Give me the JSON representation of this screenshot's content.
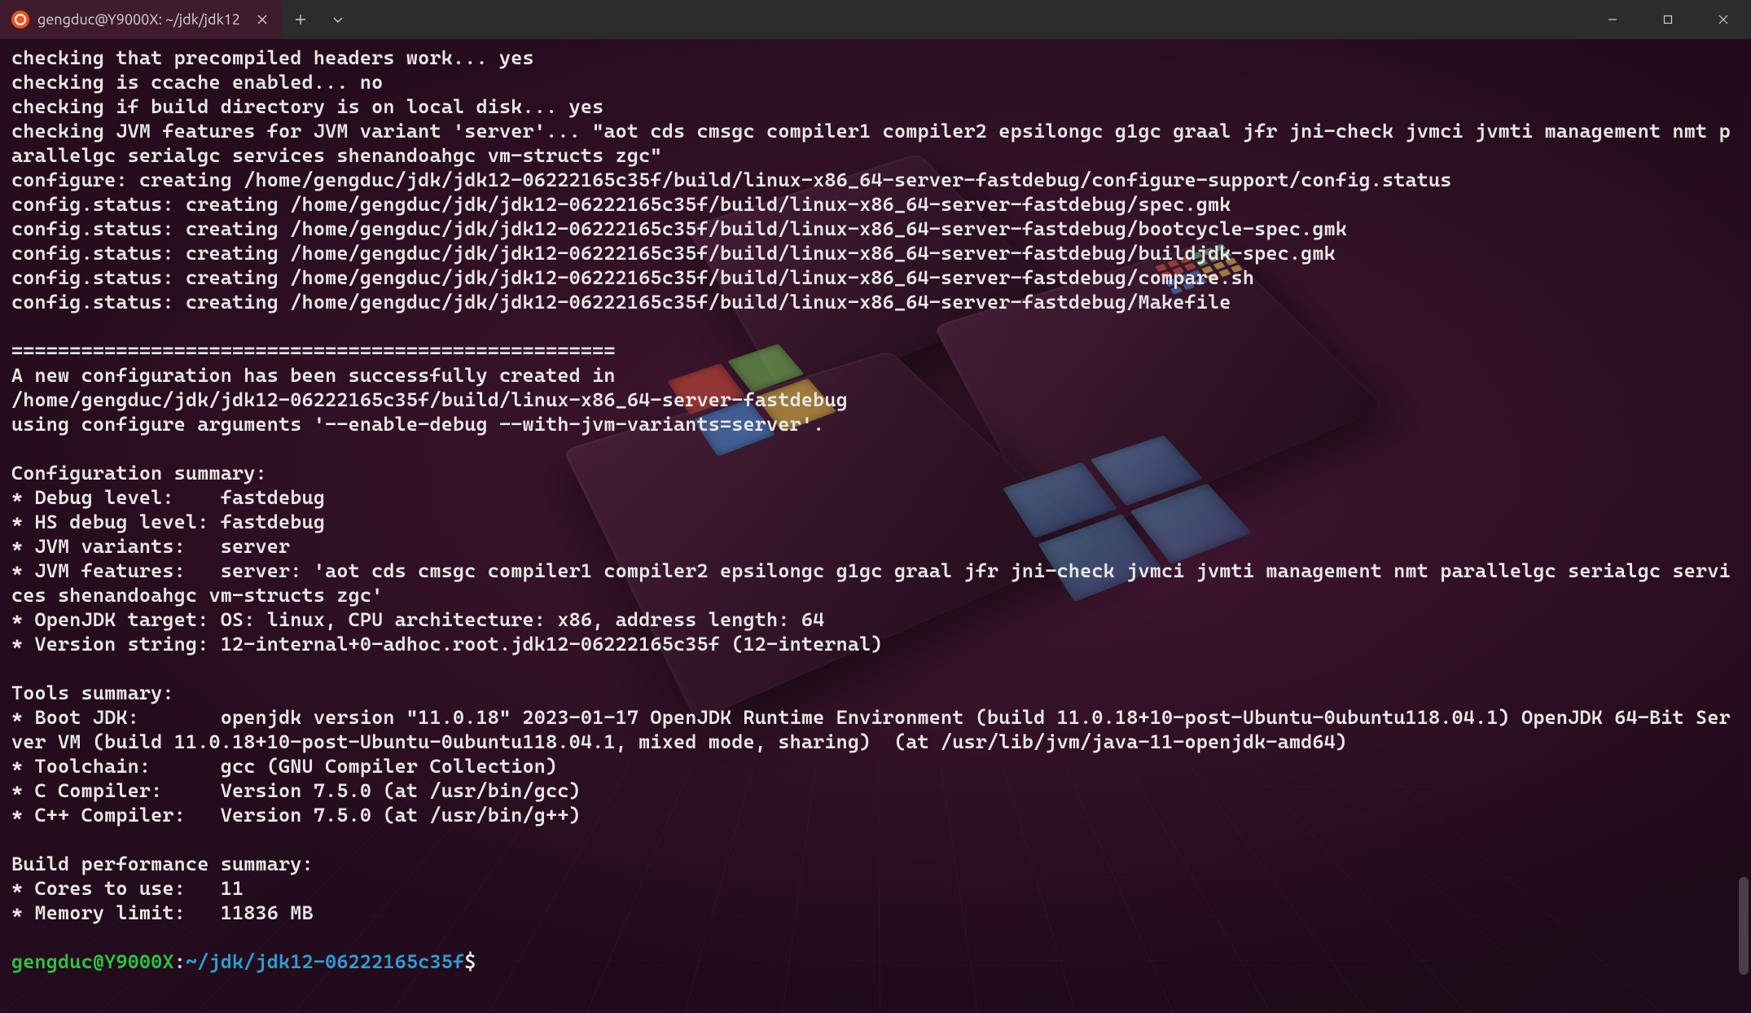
{
  "titlebar": {
    "tab_title": "gengduc@Y9000X: ~/jdk/jdk12",
    "tab_close_glyph": "✕",
    "new_tab_glyph": "+",
    "dropdown_glyph": "⌄",
    "minimize_glyph": "—",
    "maximize_glyph": "▢",
    "close_glyph": "✕"
  },
  "terminal": {
    "lines": [
      "checking that precompiled headers work... yes",
      "checking is ccache enabled... no",
      "checking if build directory is on local disk... yes",
      "checking JVM features for JVM variant 'server'... \"aot cds cmsgc compiler1 compiler2 epsilongc g1gc graal jfr jni-check jvmci jvmti management nmt parallelgc serialgc services shenandoahgc vm-structs zgc\"",
      "configure: creating /home/gengduc/jdk/jdk12-06222165c35f/build/linux-x86_64-server-fastdebug/configure-support/config.status",
      "config.status: creating /home/gengduc/jdk/jdk12-06222165c35f/build/linux-x86_64-server-fastdebug/spec.gmk",
      "config.status: creating /home/gengduc/jdk/jdk12-06222165c35f/build/linux-x86_64-server-fastdebug/bootcycle-spec.gmk",
      "config.status: creating /home/gengduc/jdk/jdk12-06222165c35f/build/linux-x86_64-server-fastdebug/buildjdk-spec.gmk",
      "config.status: creating /home/gengduc/jdk/jdk12-06222165c35f/build/linux-x86_64-server-fastdebug/compare.sh",
      "config.status: creating /home/gengduc/jdk/jdk12-06222165c35f/build/linux-x86_64-server-fastdebug/Makefile",
      "",
      "====================================================",
      "A new configuration has been successfully created in",
      "/home/gengduc/jdk/jdk12-06222165c35f/build/linux-x86_64-server-fastdebug",
      "using configure arguments '--enable-debug --with-jvm-variants=server'.",
      "",
      "Configuration summary:",
      "* Debug level:    fastdebug",
      "* HS debug level: fastdebug",
      "* JVM variants:   server",
      "* JVM features:   server: 'aot cds cmsgc compiler1 compiler2 epsilongc g1gc graal jfr jni-check jvmci jvmti management nmt parallelgc serialgc services shenandoahgc vm-structs zgc'",
      "* OpenJDK target: OS: linux, CPU architecture: x86, address length: 64",
      "* Version string: 12-internal+0-adhoc.root.jdk12-06222165c35f (12-internal)",
      "",
      "Tools summary:",
      "* Boot JDK:       openjdk version \"11.0.18\" 2023-01-17 OpenJDK Runtime Environment (build 11.0.18+10-post-Ubuntu-0ubuntu118.04.1) OpenJDK 64-Bit Server VM (build 11.0.18+10-post-Ubuntu-0ubuntu118.04.1, mixed mode, sharing)  (at /usr/lib/jvm/java-11-openjdk-amd64)",
      "* Toolchain:      gcc (GNU Compiler Collection)",
      "* C Compiler:     Version 7.5.0 (at /usr/bin/gcc)",
      "* C++ Compiler:   Version 7.5.0 (at /usr/bin/g++)",
      "",
      "Build performance summary:",
      "* Cores to use:   11",
      "* Memory limit:   11836 MB",
      ""
    ],
    "prompt": {
      "user_host": "gengduc@Y9000X",
      "colon": ":",
      "path": "~/jdk/jdk12-06222165c35f",
      "symbol": "$"
    }
  }
}
